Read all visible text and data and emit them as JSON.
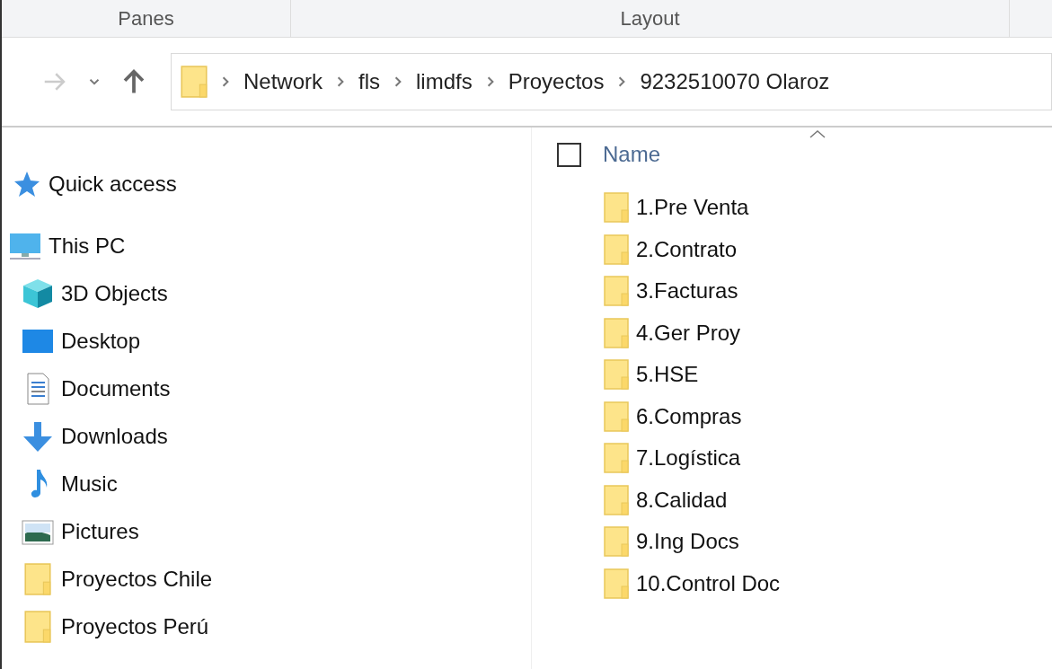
{
  "ribbon": {
    "groups": [
      "Panes",
      "Layout"
    ]
  },
  "address_bar": {
    "breadcrumbs": [
      "Network",
      "fls",
      "limdfs",
      "Proyectos",
      "9232510070 Olaroz"
    ]
  },
  "sidebar": {
    "items": [
      {
        "label": "Quick access",
        "kind": "star"
      },
      {
        "label": "This PC",
        "kind": "pc",
        "children": [
          {
            "label": "3D Objects",
            "kind": "cube"
          },
          {
            "label": "Desktop",
            "kind": "desktop"
          },
          {
            "label": "Documents",
            "kind": "documents"
          },
          {
            "label": "Downloads",
            "kind": "download"
          },
          {
            "label": "Music",
            "kind": "music"
          },
          {
            "label": "Pictures",
            "kind": "pictures"
          },
          {
            "label": "Proyectos Chile",
            "kind": "folder"
          },
          {
            "label": "Proyectos Perú",
            "kind": "folder"
          }
        ]
      }
    ]
  },
  "file_list": {
    "columns": [
      "Name"
    ],
    "select_all": {
      "checked": false
    },
    "rows": [
      {
        "name": "1.Pre Venta"
      },
      {
        "name": "2.Contrato"
      },
      {
        "name": "3.Facturas"
      },
      {
        "name": "4.Ger Proy"
      },
      {
        "name": "5.HSE"
      },
      {
        "name": "6.Compras"
      },
      {
        "name": "7.Logística"
      },
      {
        "name": "8.Calidad"
      },
      {
        "name": "9.Ing Docs"
      },
      {
        "name": "10.Control Doc"
      }
    ]
  }
}
